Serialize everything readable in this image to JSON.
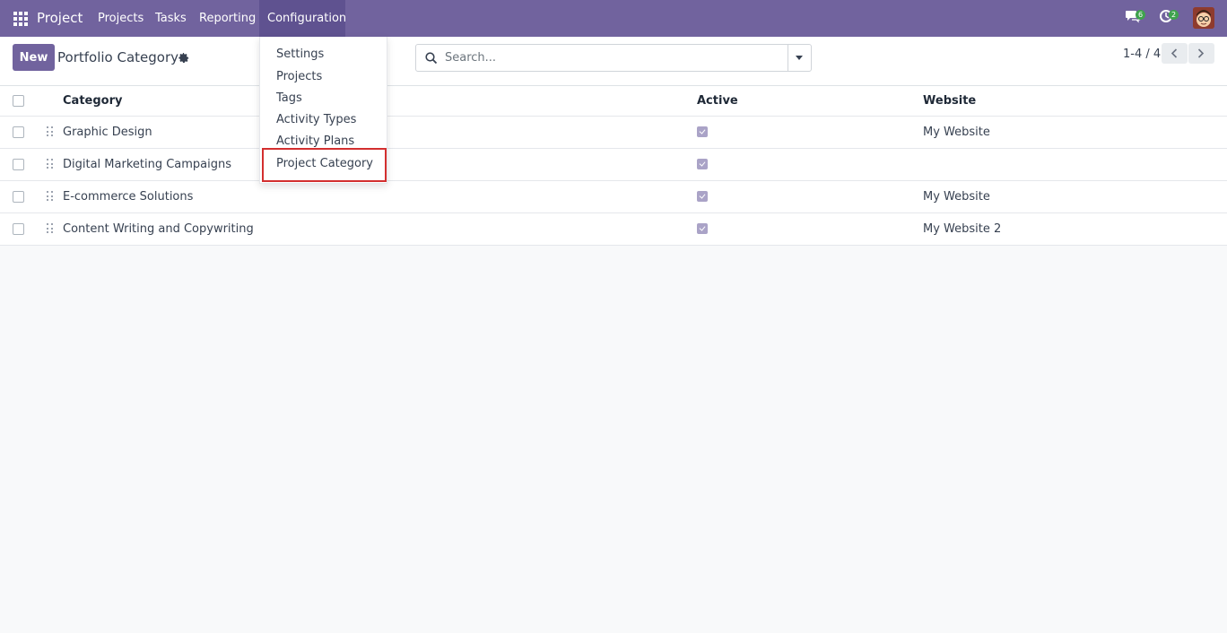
{
  "navbar": {
    "brand": "Project",
    "menu": [
      {
        "label": "Projects"
      },
      {
        "label": "Tasks"
      },
      {
        "label": "Reporting"
      },
      {
        "label": "Configuration"
      }
    ],
    "messages_count": "6",
    "activities_count": "2"
  },
  "control_panel": {
    "new_label": "New",
    "title": "Portfolio Category",
    "search_placeholder": "Search...",
    "pager": "1-4 / 4"
  },
  "list": {
    "columns": {
      "category": "Category",
      "active": "Active",
      "website": "Website"
    },
    "rows": [
      {
        "category": "Graphic Design",
        "active": true,
        "website": "My Website"
      },
      {
        "category": "Digital Marketing Campaigns",
        "active": true,
        "website": ""
      },
      {
        "category": "E-commerce Solutions",
        "active": true,
        "website": "My Website"
      },
      {
        "category": "Content Writing and Copywriting",
        "active": true,
        "website": "My Website 2"
      }
    ]
  },
  "config_menu": {
    "items": [
      {
        "label": "Settings"
      },
      {
        "label": "Projects"
      },
      {
        "label": "Tags"
      },
      {
        "label": "Activity Types"
      },
      {
        "label": "Activity Plans"
      },
      {
        "label": "Project Category"
      }
    ]
  },
  "colors": {
    "navbar": "#71639e",
    "highlight_border": "#d32f2f",
    "badge": "#3fa34d"
  }
}
